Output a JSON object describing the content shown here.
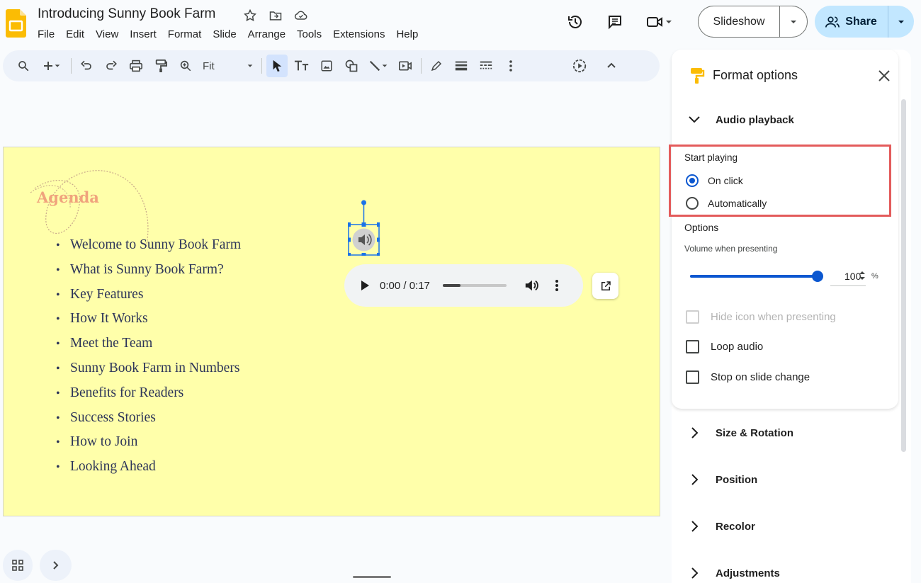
{
  "doc": {
    "title": "Introducing Sunny Book Farm"
  },
  "menu": [
    "File",
    "Edit",
    "View",
    "Insert",
    "Format",
    "Slide",
    "Arrange",
    "Tools",
    "Extensions",
    "Help"
  ],
  "header_buttons": {
    "slideshow_label": "Slideshow",
    "share_label": "Share"
  },
  "toolbar": {
    "zoom_label": "Fit"
  },
  "slide": {
    "heading": "Agenda",
    "bullets": [
      "Welcome to Sunny Book Farm",
      "What is Sunny Book Farm?",
      "Key Features",
      "How It Works",
      "Meet the Team",
      "Sunny Book Farm in Numbers",
      "Benefits for Readers",
      "Success Stories",
      "How to Join",
      "Looking Ahead"
    ],
    "audio_player": {
      "time": "0:00 / 0:17",
      "progress": 0.0
    },
    "background_color": "#ffffaa"
  },
  "panel": {
    "title": "Format options",
    "audio_section": {
      "title": "Audio playback",
      "start_playing_label": "Start playing",
      "options": [
        {
          "label": "On click",
          "checked": true
        },
        {
          "label": "Automatically",
          "checked": false
        }
      ],
      "options_label": "Options",
      "volume_label": "Volume when presenting",
      "volume_value": "100",
      "volume_unit": "%",
      "volume_level": 1.0,
      "checkboxes": [
        {
          "label": "Hide icon when presenting",
          "checked": false,
          "disabled": true
        },
        {
          "label": "Loop audio",
          "checked": false,
          "disabled": false
        },
        {
          "label": "Stop on slide change",
          "checked": false,
          "disabled": false
        }
      ]
    },
    "sections": [
      "Size & Rotation",
      "Position",
      "Recolor",
      "Adjustments"
    ]
  },
  "colors": {
    "accent": "#0b57d0",
    "share_bg": "#c2e7ff",
    "highlight": "#e35b5b",
    "slides_logo": "#fbbc04"
  }
}
